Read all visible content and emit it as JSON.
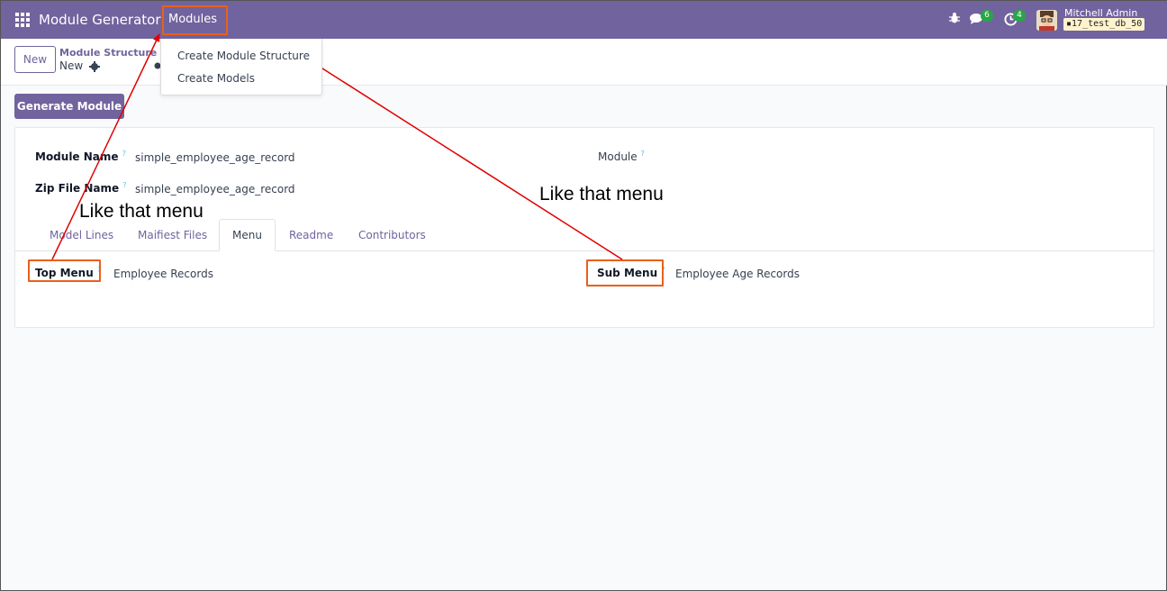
{
  "navbar": {
    "app_title": "Module Generator",
    "modules_menu": "Modules",
    "chat_count": "6",
    "activity_count": "4",
    "user_name": "Mitchell Admin",
    "db_name": "17_test_db_50"
  },
  "control_panel": {
    "new_label": "New",
    "breadcrumb": "Module Structure",
    "record_name": "New"
  },
  "dropdown": {
    "items": [
      "Create Module Structure",
      "Create Models"
    ]
  },
  "actions": {
    "generate_label": "Generate Module"
  },
  "form": {
    "module_name_label": "Module Name",
    "module_name_value": "simple_employee_age_record",
    "zip_label": "Zip File Name",
    "zip_value": "simple_employee_age_record",
    "module_label": "Module",
    "tooltip_mark": "?"
  },
  "tabs": [
    "Model Lines",
    "Maifiest Files",
    "Menu",
    "Readme",
    "Contributors"
  ],
  "menu_tab": {
    "top_menu_label": "Top Menu",
    "top_menu_value": "Employee Records",
    "sub_menu_label": "Sub Menu",
    "sub_menu_value": "Employee Age Records"
  },
  "annotations": {
    "left_note": "Like that menu",
    "right_note": "Like that menu",
    "color": "#e8601c",
    "arrow_color": "#e00000"
  },
  "colors": {
    "brand": "#71639e",
    "badge": "#28a745"
  }
}
